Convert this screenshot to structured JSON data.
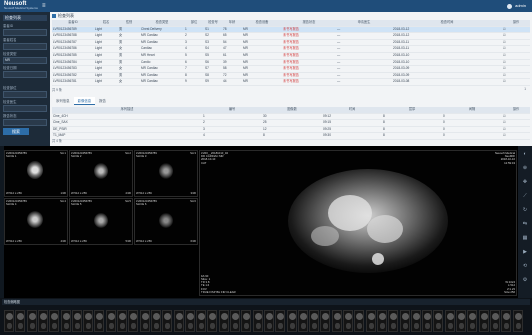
{
  "app": {
    "name": "Neusoft",
    "subtitle": "Neusoft Medical Systems"
  },
  "user": {
    "name": "admin"
  },
  "sidebar": {
    "title": "检查列表",
    "fields": [
      {
        "label": "患者ID",
        "value": ""
      },
      {
        "label": "患者姓名",
        "value": ""
      },
      {
        "label": "检查类型",
        "value": "MR"
      },
      {
        "label": "检查日期",
        "value": ""
      },
      {
        "label": "检查部位",
        "value": ""
      },
      {
        "label": "检查医生",
        "value": ""
      },
      {
        "label": "报告状态",
        "value": ""
      }
    ],
    "search_label": "搜索"
  },
  "study_panel": {
    "title": "检查列表",
    "columns": [
      "患者ID",
      "姓名",
      "性别",
      "检查类型",
      "部位",
      "检查号",
      "年龄",
      "检查设备",
      "报告状态",
      "申请医生",
      "检查时间",
      "操作"
    ],
    "rows": [
      [
        "LVR0123456789",
        "Light",
        "男",
        "Chest Delivery",
        "1",
        "S1",
        "78",
        "MR",
        "未书写报告",
        "—",
        "2018-03-12",
        "☑"
      ],
      [
        "LVR0123456788",
        "Light",
        "女",
        "MR Cardiac",
        "2",
        "S2",
        "65",
        "MR",
        "未书写报告",
        "—",
        "2018-03-12",
        "☑"
      ],
      [
        "LVR0123456787",
        "Light",
        "男",
        "MR Cardiac",
        "3",
        "S3",
        "54",
        "MR",
        "未书写报告",
        "—",
        "2018-03-11",
        "☑"
      ],
      [
        "LVR0123456786",
        "Light",
        "女",
        "Cardiac",
        "4",
        "S4",
        "47",
        "MR",
        "未书写报告",
        "—",
        "2018-03-11",
        "☑"
      ],
      [
        "LVR0123456785",
        "Light",
        "男",
        "MR Heart",
        "5",
        "S5",
        "61",
        "MR",
        "未书写报告",
        "—",
        "2018-03-10",
        "☑"
      ],
      [
        "LVR0123456784",
        "Light",
        "男",
        "Cardio",
        "6",
        "S6",
        "39",
        "MR",
        "未书写报告",
        "—",
        "2018-03-10",
        "☑"
      ],
      [
        "LVR0123456783",
        "Light",
        "女",
        "MR Cardiac",
        "7",
        "S7",
        "58",
        "MR",
        "未书写报告",
        "—",
        "2018-03-09",
        "☑"
      ],
      [
        "LVR0123456782",
        "Light",
        "男",
        "MR Cardiac",
        "8",
        "S8",
        "72",
        "MR",
        "未书写报告",
        "—",
        "2018-03-09",
        "☑"
      ],
      [
        "LVR0123456781",
        "Light",
        "女",
        "MR Cardiac",
        "9",
        "S9",
        "44",
        "MR",
        "未书写报告",
        "—",
        "2018-03-08",
        "☑"
      ]
    ],
    "pager_left": "共 9 条",
    "pager_right": "1"
  },
  "series_panel": {
    "tabs": [
      "序列信息",
      "影像信息",
      "报告"
    ],
    "columns": [
      "序列描述",
      "编号",
      "图像数",
      "时间",
      "层厚",
      "间隔",
      "操作"
    ],
    "rows": [
      [
        "Cine_4CH",
        "1",
        "30",
        "09:12",
        "8",
        "0",
        "☑"
      ],
      [
        "Cine_SAX",
        "2",
        "25",
        "09:15",
        "8",
        "0",
        "☑"
      ],
      [
        "DE_PSIR",
        "3",
        "12",
        "09:25",
        "8",
        "0",
        "☑"
      ],
      [
        "T1_MAP",
        "4",
        "8",
        "09:30",
        "8",
        "0",
        "☑"
      ]
    ],
    "pager_left": "共 4 条"
  },
  "viewer": {
    "cells": [
      {
        "tl": "LVR0123456789\nSLICE 1",
        "tr": "SA 1",
        "bl": "W:512 L:256",
        "br": "1/30"
      },
      {
        "tl": "LVR0123456789\nSLICE 2",
        "tr": "SA 2",
        "bl": "W:512 L:256",
        "br": "2/30"
      },
      {
        "tl": "LVR0123456789\nSLICE 3",
        "tr": "SA 3",
        "bl": "W:512 L:256",
        "br": "3/30"
      },
      {
        "tl": "LVR0123456789\nSLICE 4",
        "tr": "SA 4",
        "bl": "W:512 L:256",
        "br": "4/30"
      },
      {
        "tl": "LVR0123456789\nSLICE 5",
        "tr": "SA 5",
        "bl": "W:512 L:256",
        "br": "5/30"
      },
      {
        "tl": "LVR0123456789\nSLICE 6",
        "tr": "SA 6",
        "bl": "W:512 L:256",
        "br": "6/30"
      }
    ],
    "main": {
      "tl": "LVR0__20181010_02\nDR CARDIAC MR\n2018-10-10\nCAT",
      "tr": "Neusoft Medical\nNeuMRI\n2018-10-10\n12:59:43",
      "bl": "FA:90\nSlice: 1\nTR 3.8\nTE 1.6\nFOV\nTRUE FISP BH FIR CLEAR",
      "br": "W:1024\nL:512\nZ:1.23\nSize:256"
    },
    "thumb_header": "检查缩略图"
  }
}
